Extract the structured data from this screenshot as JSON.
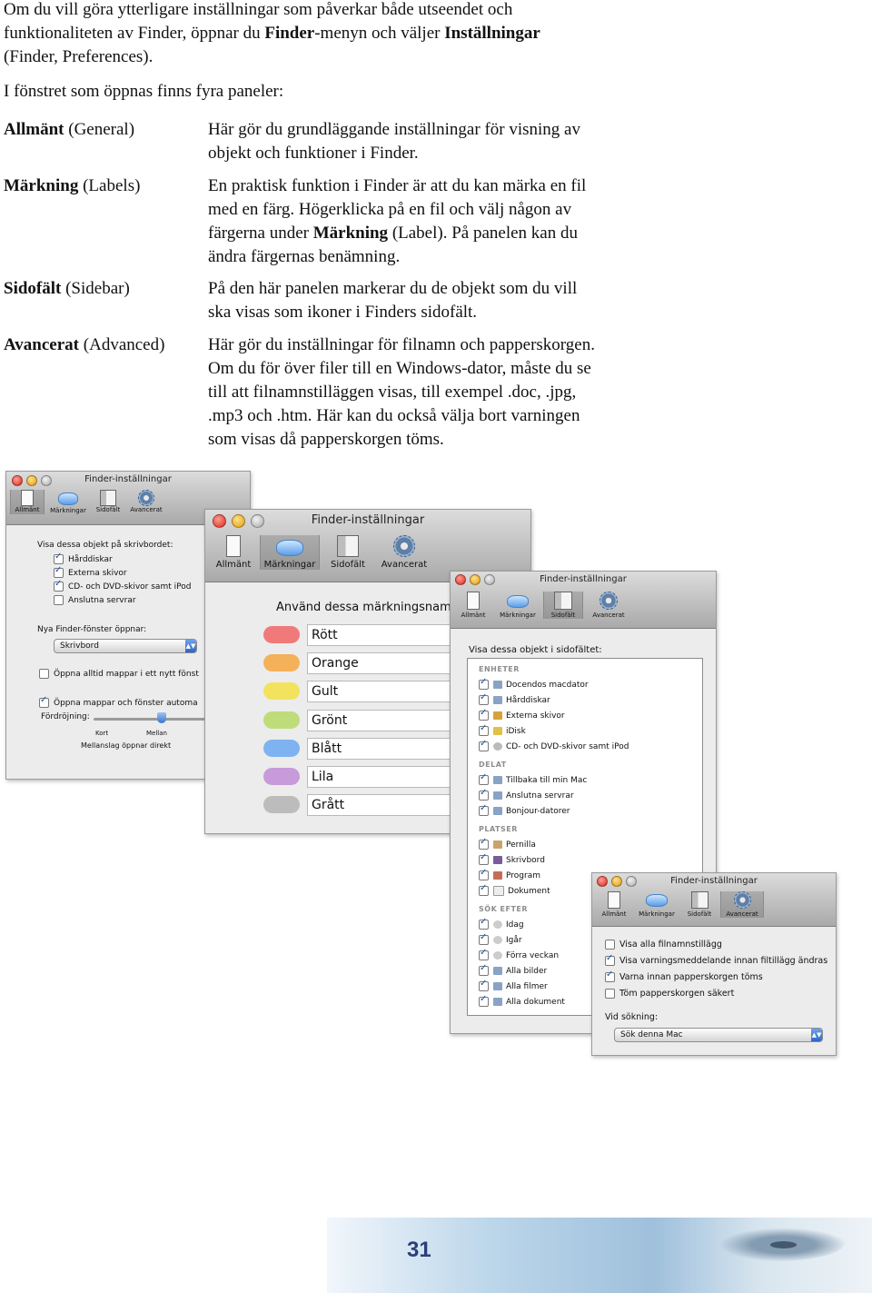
{
  "intro": {
    "t1": "Om du vill göra ytterligare inställningar som påverkar både utseendet och funktionaliteten av Finder, öppnar du ",
    "b1": "Finder",
    "t2": "-menyn och väljer ",
    "b2": "Inställningar",
    "t3": " (Finder, Preferences)."
  },
  "lead": "I fönstret som öppnas finns fyra paneler:",
  "panels": [
    {
      "term": "Allmänt",
      "term_en": " (General)",
      "desc": "Här gör du grundläggande inställningar för visning av objekt och funktioner i Finder."
    },
    {
      "term": "Märkning",
      "term_en": " (Labels)",
      "desc_a": "En praktisk funktion i Finder är att du kan märka en fil med en färg. Högerklicka på en fil och välj någon av färgerna under ",
      "desc_b": "Märkning",
      "desc_c": " (Label). På panelen kan du ändra färgernas benämning."
    },
    {
      "term": "Sidofält",
      "term_en": " (Sidebar)",
      "desc": "På den här panelen markerar du de objekt som du vill ska visas som ikoner i Finders sidofält."
    },
    {
      "term": "Avancerat",
      "term_en": " (Advanced)",
      "desc": "Här gör du inställningar för filnamn och papperskorgen. Om du för över filer till en Windows-dator, måste du se till att filnamnstilläggen visas, till exempel .doc, .jpg, .mp3 och .htm. Här kan du också välja bort varningen som visas då papperskorgen töms."
    }
  ],
  "window_title": "Finder-inställningar",
  "toolbar": [
    "Allmänt",
    "Märkningar",
    "Sidofält",
    "Avancerat"
  ],
  "general": {
    "heading": "Visa dessa objekt på skrivbordet:",
    "items": [
      "Hårddiskar",
      "Externa skivor",
      "CD- och DVD-skivor samt iPod",
      "Anslutna servrar"
    ],
    "new_window_label": "Nya Finder-fönster öppnar:",
    "new_window_value": "Skrivbord",
    "open_tabs": "Öppna alltid mappar i ett nytt fönst",
    "spring": "Öppna mappar och fönster automa",
    "delay": "Fördröjning:",
    "short": "Kort",
    "medium": "Mellan",
    "hint": "Mellanslag öppnar direkt"
  },
  "labels": {
    "heading": "Använd dessa märkningsnamn",
    "names": [
      "Rött",
      "Orange",
      "Gult",
      "Grönt",
      "Blått",
      "Lila",
      "Grått"
    ],
    "colors": [
      "#f07a7a",
      "#f5b15a",
      "#f2e25e",
      "#bfdc7a",
      "#7fb2f0",
      "#c79ad9",
      "#bcbcbc"
    ]
  },
  "sidebar": {
    "heading": "Visa dessa objekt i sidofältet:",
    "groups": [
      {
        "name": "ENHETER",
        "items": [
          "Docendos macdator",
          "Hårddiskar",
          "Externa skivor",
          "iDisk",
          "CD- och DVD-skivor samt iPod"
        ]
      },
      {
        "name": "DELAT",
        "items": [
          "Tillbaka till min Mac",
          "Anslutna servrar",
          "Bonjour-datorer"
        ]
      },
      {
        "name": "PLATSER",
        "items": [
          "Pernilla",
          "Skrivbord",
          "Program",
          "Dokument"
        ]
      },
      {
        "name": "SÖK EFTER",
        "items": [
          "Idag",
          "Igår",
          "Förra veckan",
          "Alla bilder",
          "Alla filmer",
          "Alla dokument"
        ]
      }
    ]
  },
  "advanced": {
    "items": [
      "Visa alla filnamnstillägg",
      "Visa varningsmeddelande innan filtillägg ändras",
      "Varna innan papperskorgen töms",
      "Töm papperskorgen säkert"
    ],
    "checked": [
      false,
      true,
      true,
      false
    ],
    "search_label": "Vid sökning:",
    "search_value": "Sök denna Mac"
  },
  "page_number": "31"
}
